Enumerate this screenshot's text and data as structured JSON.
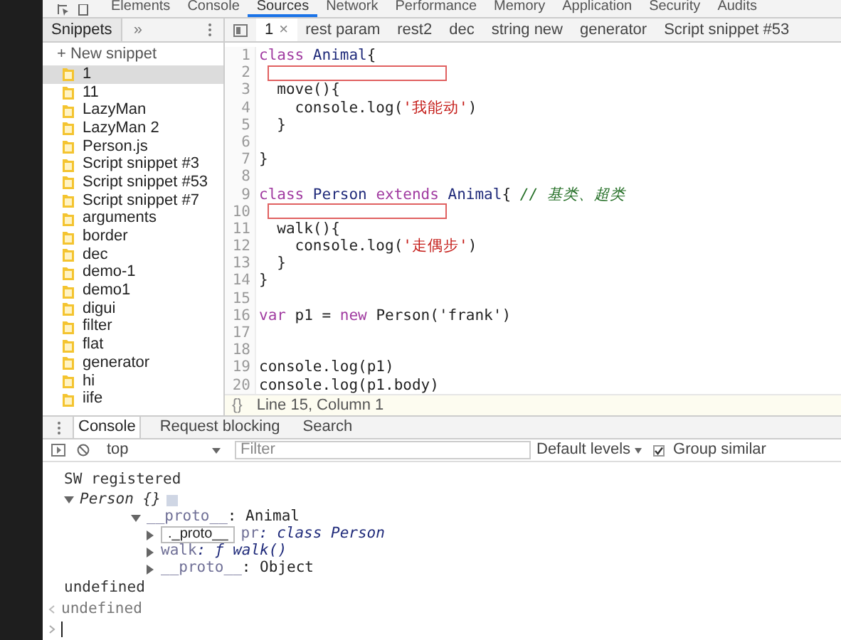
{
  "main_tabs": [
    {
      "label": "Elements",
      "selected": false
    },
    {
      "label": "Console",
      "selected": false
    },
    {
      "label": "Sources",
      "selected": true
    },
    {
      "label": "Network",
      "selected": false
    },
    {
      "label": "Performance",
      "selected": false
    },
    {
      "label": "Memory",
      "selected": false
    },
    {
      "label": "Application",
      "selected": false
    },
    {
      "label": "Security",
      "selected": false
    },
    {
      "label": "Audits",
      "selected": false
    }
  ],
  "sidebar": {
    "tab": "Snippets",
    "more": "»",
    "new_snippet": "+ New snippet",
    "items": [
      {
        "label": "1",
        "selected": true
      },
      {
        "label": "11",
        "selected": false
      },
      {
        "label": "LazyMan",
        "selected": false
      },
      {
        "label": "LazyMan 2",
        "selected": false
      },
      {
        "label": "Person.js",
        "selected": false
      },
      {
        "label": "Script snippet #3",
        "selected": false
      },
      {
        "label": "Script snippet #53",
        "selected": false
      },
      {
        "label": "Script snippet #7",
        "selected": false
      },
      {
        "label": "arguments",
        "selected": false
      },
      {
        "label": "border",
        "selected": false
      },
      {
        "label": "dec",
        "selected": false
      },
      {
        "label": "demo-1",
        "selected": false
      },
      {
        "label": "demo1",
        "selected": false
      },
      {
        "label": "digui",
        "selected": false
      },
      {
        "label": "filter",
        "selected": false
      },
      {
        "label": "flat",
        "selected": false
      },
      {
        "label": "generator",
        "selected": false
      },
      {
        "label": "hi",
        "selected": false
      },
      {
        "label": "iife",
        "selected": false
      }
    ]
  },
  "editor_tabs": [
    {
      "label": "1",
      "close": "×",
      "selected": true
    },
    {
      "label": "rest param",
      "selected": false
    },
    {
      "label": "rest2",
      "selected": false
    },
    {
      "label": "dec",
      "selected": false
    },
    {
      "label": "string new",
      "selected": false
    },
    {
      "label": "generator",
      "selected": false
    },
    {
      "label": "Script snippet #53",
      "selected": false
    }
  ],
  "code": [
    {
      "number": "1",
      "highlight": false,
      "segments": [
        {
          "kind": "keyword",
          "text": "class"
        },
        {
          "kind": "def",
          "text": " Animal"
        },
        {
          "kind": "plain",
          "text": "{"
        }
      ]
    },
    {
      "number": "2",
      "highlight": true
    },
    {
      "number": "3",
      "highlight": false,
      "segments": [
        {
          "kind": "plain",
          "text": "  move(){"
        }
      ]
    },
    {
      "number": "4",
      "highlight": false,
      "segments": [
        {
          "kind": "plain",
          "text": "    console.log("
        },
        {
          "kind": "string",
          "text": "'我能动'"
        },
        {
          "kind": "plain",
          "text": ")"
        }
      ]
    },
    {
      "number": "5",
      "highlight": false,
      "segments": [
        {
          "kind": "plain",
          "text": "  }"
        }
      ]
    },
    {
      "number": "6",
      "highlight": false
    },
    {
      "number": "7",
      "highlight": false,
      "segments": [
        {
          "kind": "plain",
          "text": "}"
        }
      ]
    },
    {
      "number": "8",
      "highlight": false
    },
    {
      "number": "9",
      "highlight": false,
      "segments": [
        {
          "kind": "keyword",
          "text": "class"
        },
        {
          "kind": "def",
          "text": " Person"
        },
        {
          "kind": "keyword",
          "text": " extends"
        },
        {
          "kind": "def",
          "text": " Animal"
        },
        {
          "kind": "plain",
          "text": "{ "
        },
        {
          "kind": "comment",
          "text": "// 基类、超类"
        }
      ]
    },
    {
      "number": "10",
      "highlight": true
    },
    {
      "number": "11",
      "highlight": false,
      "segments": [
        {
          "kind": "plain",
          "text": "  walk(){"
        }
      ]
    },
    {
      "number": "12",
      "highlight": false,
      "segments": [
        {
          "kind": "plain",
          "text": "    console.log("
        },
        {
          "kind": "string",
          "text": "'走偶步'"
        },
        {
          "kind": "plain",
          "text": ")"
        }
      ]
    },
    {
      "number": "13",
      "highlight": false,
      "segments": [
        {
          "kind": "plain",
          "text": "  }"
        }
      ]
    },
    {
      "number": "14",
      "highlight": false,
      "segments": [
        {
          "kind": "plain",
          "text": "}"
        }
      ]
    },
    {
      "number": "15",
      "highlight": false
    },
    {
      "number": "16",
      "highlight": false,
      "segments": [
        {
          "kind": "keyword",
          "text": "var"
        },
        {
          "kind": "plain",
          "text": " p1 = "
        },
        {
          "kind": "keyword",
          "text": "new"
        },
        {
          "kind": "plain",
          "text": " Person('frank')"
        }
      ]
    },
    {
      "number": "17",
      "highlight": false
    },
    {
      "number": "18",
      "highlight": false
    },
    {
      "number": "19",
      "highlight": false,
      "segments": [
        {
          "kind": "plain",
          "text": "console.log(p1)"
        }
      ]
    },
    {
      "number": "20",
      "highlight": false,
      "segments": [
        {
          "kind": "plain",
          "text": "console.log(p1.body)"
        }
      ]
    }
  ],
  "status_bar": {
    "format_icon": "{}",
    "position": "Line 15, Column 1"
  },
  "drawer_tabs": [
    {
      "label": "Console",
      "selected": true
    },
    {
      "label": "Request blocking",
      "selected": false
    },
    {
      "label": "Search",
      "selected": false
    }
  ],
  "console_toolbar": {
    "context": "top",
    "filter": {
      "placeholder": "Filter"
    },
    "levels": "Default levels",
    "group_similar": {
      "label": "Group similar",
      "checked": true
    }
  },
  "console": [
    {
      "kind": "log",
      "text": "SW registered"
    },
    {
      "kind": "object",
      "label": "Person {}",
      "expanded": true,
      "children": [
        {
          "key": "__proto__",
          "value": ": Animal",
          "italic": false,
          "expanded": true,
          "children": [
            {
              "key": "pr",
              "value": ": class Person",
              "italic": true,
              "expanded": false,
              "tooltip": "._proto__"
            },
            {
              "key": "walk",
              "value": ": ƒ walk()",
              "italic": true,
              "expanded": false
            },
            {
              "key": "__proto__",
              "value": ": Object",
              "italic": false,
              "expanded": false
            }
          ]
        }
      ]
    },
    {
      "kind": "log",
      "text": "undefined"
    },
    {
      "kind": "result",
      "text": "undefined"
    },
    {
      "kind": "prompt"
    }
  ]
}
